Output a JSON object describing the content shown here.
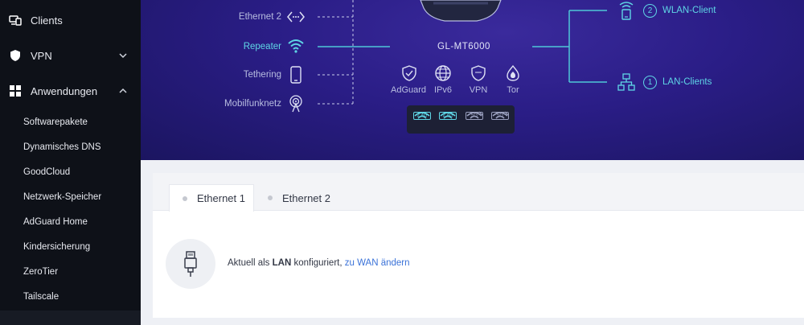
{
  "sidebar": {
    "items": [
      {
        "label": "Clients",
        "icon": "devices-icon"
      },
      {
        "label": "VPN",
        "icon": "shield-icon"
      },
      {
        "label": "Anwendungen",
        "icon": "apps-grid-icon"
      }
    ],
    "subitems": [
      "Softwarepakete",
      "Dynamisches DNS",
      "GoodCloud",
      "Netzwerk-Speicher",
      "AdGuard Home",
      "Kindersicherung",
      "ZeroTier",
      "Tailscale"
    ]
  },
  "topology": {
    "wan_sources": [
      {
        "label": "Ethernet 2",
        "icon": "ethernet-arrows-icon",
        "active": false
      },
      {
        "label": "Repeater",
        "icon": "wifi-icon",
        "active": true
      },
      {
        "label": "Tethering",
        "icon": "phone-icon",
        "active": false
      },
      {
        "label": "Mobilfunknetz",
        "icon": "cellular-tower-icon",
        "active": false
      }
    ],
    "device_name": "GL-MT6000",
    "features": [
      {
        "label": "AdGuard",
        "icon": "adguard-shield-icon"
      },
      {
        "label": "IPv6",
        "icon": "globe-icon"
      },
      {
        "label": "VPN",
        "icon": "vpn-shield-icon"
      },
      {
        "label": "Tor",
        "icon": "tor-onion-icon"
      }
    ],
    "bands": [
      "2.4G",
      "2.4G",
      "5G",
      "5G"
    ],
    "clients": [
      {
        "count": "2",
        "label": "WLAN-Client",
        "icon": "wifi-device-icon"
      },
      {
        "count": "1",
        "label": "LAN-Clients",
        "icon": "lan-network-icon"
      }
    ],
    "colors": {
      "accent": "#5fd6e6",
      "line": "#4fc8d8",
      "bg": "#2a1d86"
    }
  },
  "ports": {
    "tabs": [
      "Ethernet 1",
      "Ethernet 2"
    ],
    "active_tab": "Ethernet 1",
    "status_prefix": "Aktuell als",
    "status_mode": "LAN",
    "status_suffix": "konfiguriert,",
    "status_link": "zu WAN ändern"
  }
}
